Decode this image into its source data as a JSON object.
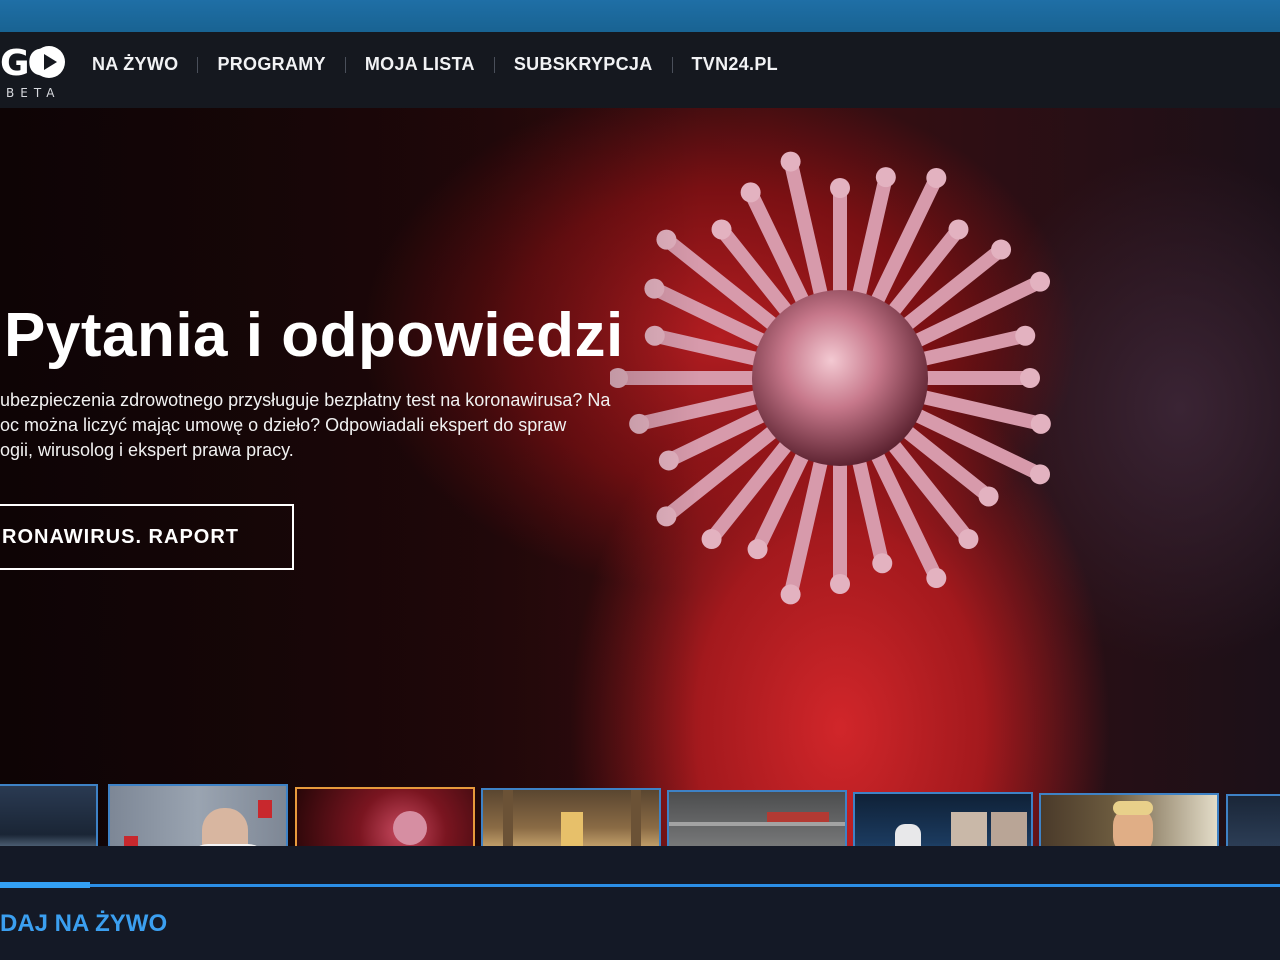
{
  "app": {
    "logo_text": "GO",
    "logo_badge": "BETA"
  },
  "nav": {
    "items": [
      {
        "label": "NA ŻYWO"
      },
      {
        "label": "PROGRAMY"
      },
      {
        "label": "MOJA LISTA"
      },
      {
        "label": "SUBSKRYPCJA"
      },
      {
        "label": "TVN24.PL"
      }
    ]
  },
  "hero": {
    "title": "Pytania i odpowiedzi",
    "description": "ubezpieczenia zdrowotnego przysługuje bezpłatny test na koronawirusa? Na\noc można liczyć mając umowę o dzieło? Odpowiadali ekspert do spraw\nogii, wirusolog i ekspert prawa pracy.",
    "button_label": "RONAWIRUS. RAPORT"
  },
  "carousel": {
    "items": [
      {
        "name": "thumb-tv-studio"
      },
      {
        "name": "thumb-minister-press"
      },
      {
        "name": "thumb-virus",
        "active": true
      },
      {
        "name": "thumb-cathedral"
      },
      {
        "name": "thumb-hospital"
      },
      {
        "name": "thumb-news-studio"
      },
      {
        "name": "thumb-trump"
      },
      {
        "name": "thumb-partial"
      }
    ]
  },
  "live_section": {
    "title": "DAJ NA ŻYWO",
    "progress": 0.07
  },
  "colors": {
    "accent_blue": "#3b9ff0",
    "nav_bg": "#15181f",
    "thumb_border": "#3e82c6",
    "thumb_active_border": "#e79a3c"
  }
}
